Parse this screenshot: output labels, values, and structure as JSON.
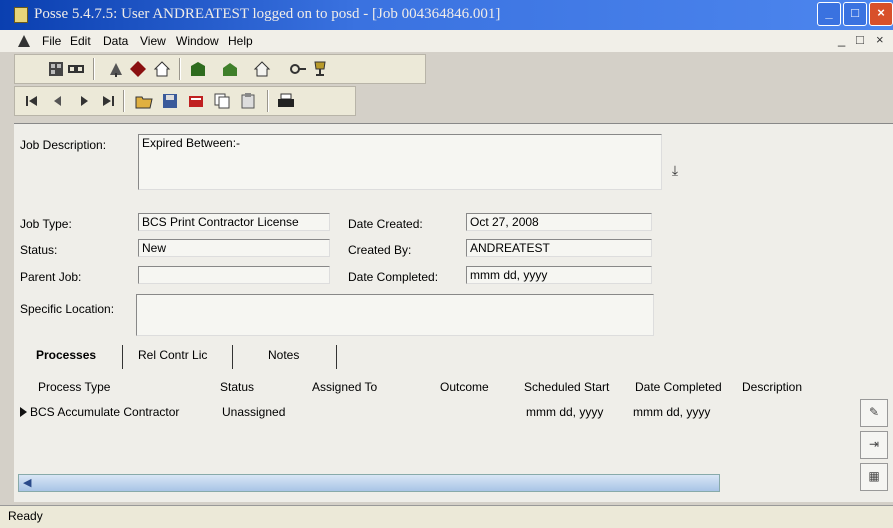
{
  "window": {
    "title": "Posse 5.4.7.5: User ANDREATEST logged on to posd - [Job 004364846.001]"
  },
  "menu": [
    "File",
    "Edit",
    "Data",
    "View",
    "Window",
    "Help"
  ],
  "mdi_controls": [
    "_",
    "□",
    "×"
  ],
  "toolbar1_icons": [
    "grid-icon",
    "link-icon",
    "tree-icon",
    "diamond-icon",
    "home-icon",
    "green-building-icon",
    "green-building2-icon",
    "house-icon",
    "key-icon",
    "trophy-icon"
  ],
  "toolbar2_icons": [
    "first-record-icon",
    "prev-record-icon",
    "next-record-icon",
    "last-record-icon",
    "open-folder-icon",
    "save-icon",
    "delete-icon",
    "copy-icon",
    "paste-icon",
    "print-icon"
  ],
  "form": {
    "job_description_label": "Job Description:",
    "job_description_value": "Expired Between:-",
    "job_type_label": "Job Type:",
    "job_type_value": "BCS Print Contractor License",
    "status_label": "Status:",
    "status_value": "New",
    "parent_job_label": "Parent Job:",
    "parent_job_value": "",
    "specific_location_label": "Specific Location:",
    "specific_location_value": "",
    "date_created_label": "Date Created:",
    "date_created_value": "Oct 27, 2008",
    "created_by_label": "Created By:",
    "created_by_value": "ANDREATEST",
    "date_completed_label": "Date Completed:",
    "date_completed_value": "mmm dd, yyyy"
  },
  "tabs": [
    "Processes",
    "Rel Contr Lic",
    "Notes"
  ],
  "table": {
    "headers": [
      "Process Type",
      "Status",
      "Assigned To",
      "Outcome",
      "Scheduled Start",
      "Date Completed",
      "Description"
    ],
    "rows": [
      {
        "process_type": "BCS Accumulate Contractor",
        "status": "Unassigned",
        "assigned_to": "",
        "outcome": "",
        "scheduled_start": "mmm dd, yyyy",
        "date_completed": "mmm dd, yyyy",
        "description": ""
      }
    ]
  },
  "status_bar": "Ready"
}
